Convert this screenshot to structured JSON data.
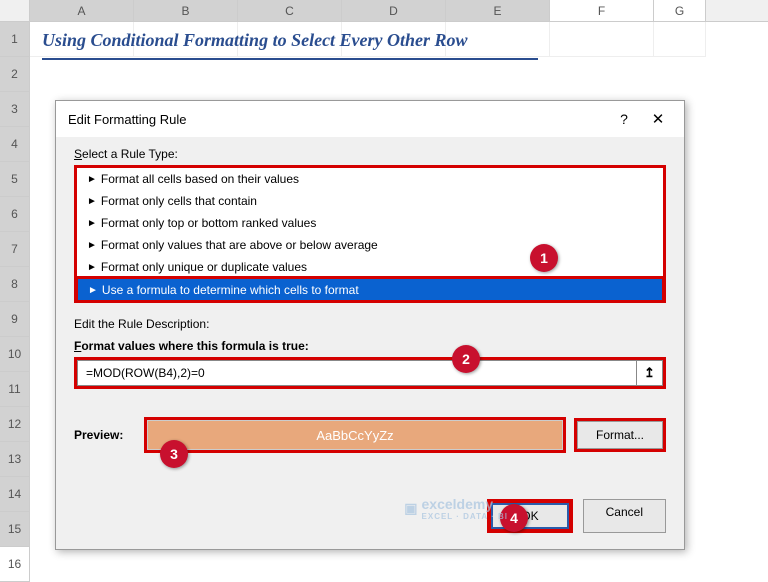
{
  "sheet": {
    "columns": [
      "A",
      "B",
      "C",
      "D",
      "E",
      "F",
      "G"
    ],
    "rows": [
      "1",
      "2",
      "3",
      "4",
      "5",
      "6",
      "7",
      "8",
      "9",
      "10",
      "11",
      "12",
      "13",
      "14",
      "15",
      "16"
    ],
    "title": "Using Conditional Formatting to Select Every Other Row"
  },
  "dialog": {
    "title": "Edit Formatting Rule",
    "ruleTypeLabel": "Select a Rule Type:",
    "ruleTypes": [
      "Format all cells based on their values",
      "Format only cells that contain",
      "Format only top or bottom ranked values",
      "Format only values that are above or below average",
      "Format only unique or duplicate values",
      "Use a formula to determine which cells to format"
    ],
    "descLabel": "Edit the Rule Description:",
    "formulaLabel": "Format values where this formula is true:",
    "formula": "=MOD(ROW(B4),2)=0",
    "previewLabel": "Preview:",
    "previewText": "AaBbCcYyZz",
    "formatBtn": "Format...",
    "okBtn": "OK",
    "cancelBtn": "Cancel"
  },
  "callouts": {
    "c1": "1",
    "c2": "2",
    "c3": "3",
    "c4": "4"
  },
  "watermark": {
    "brand": "exceldemy",
    "sub": "EXCEL · DATA · BI"
  }
}
